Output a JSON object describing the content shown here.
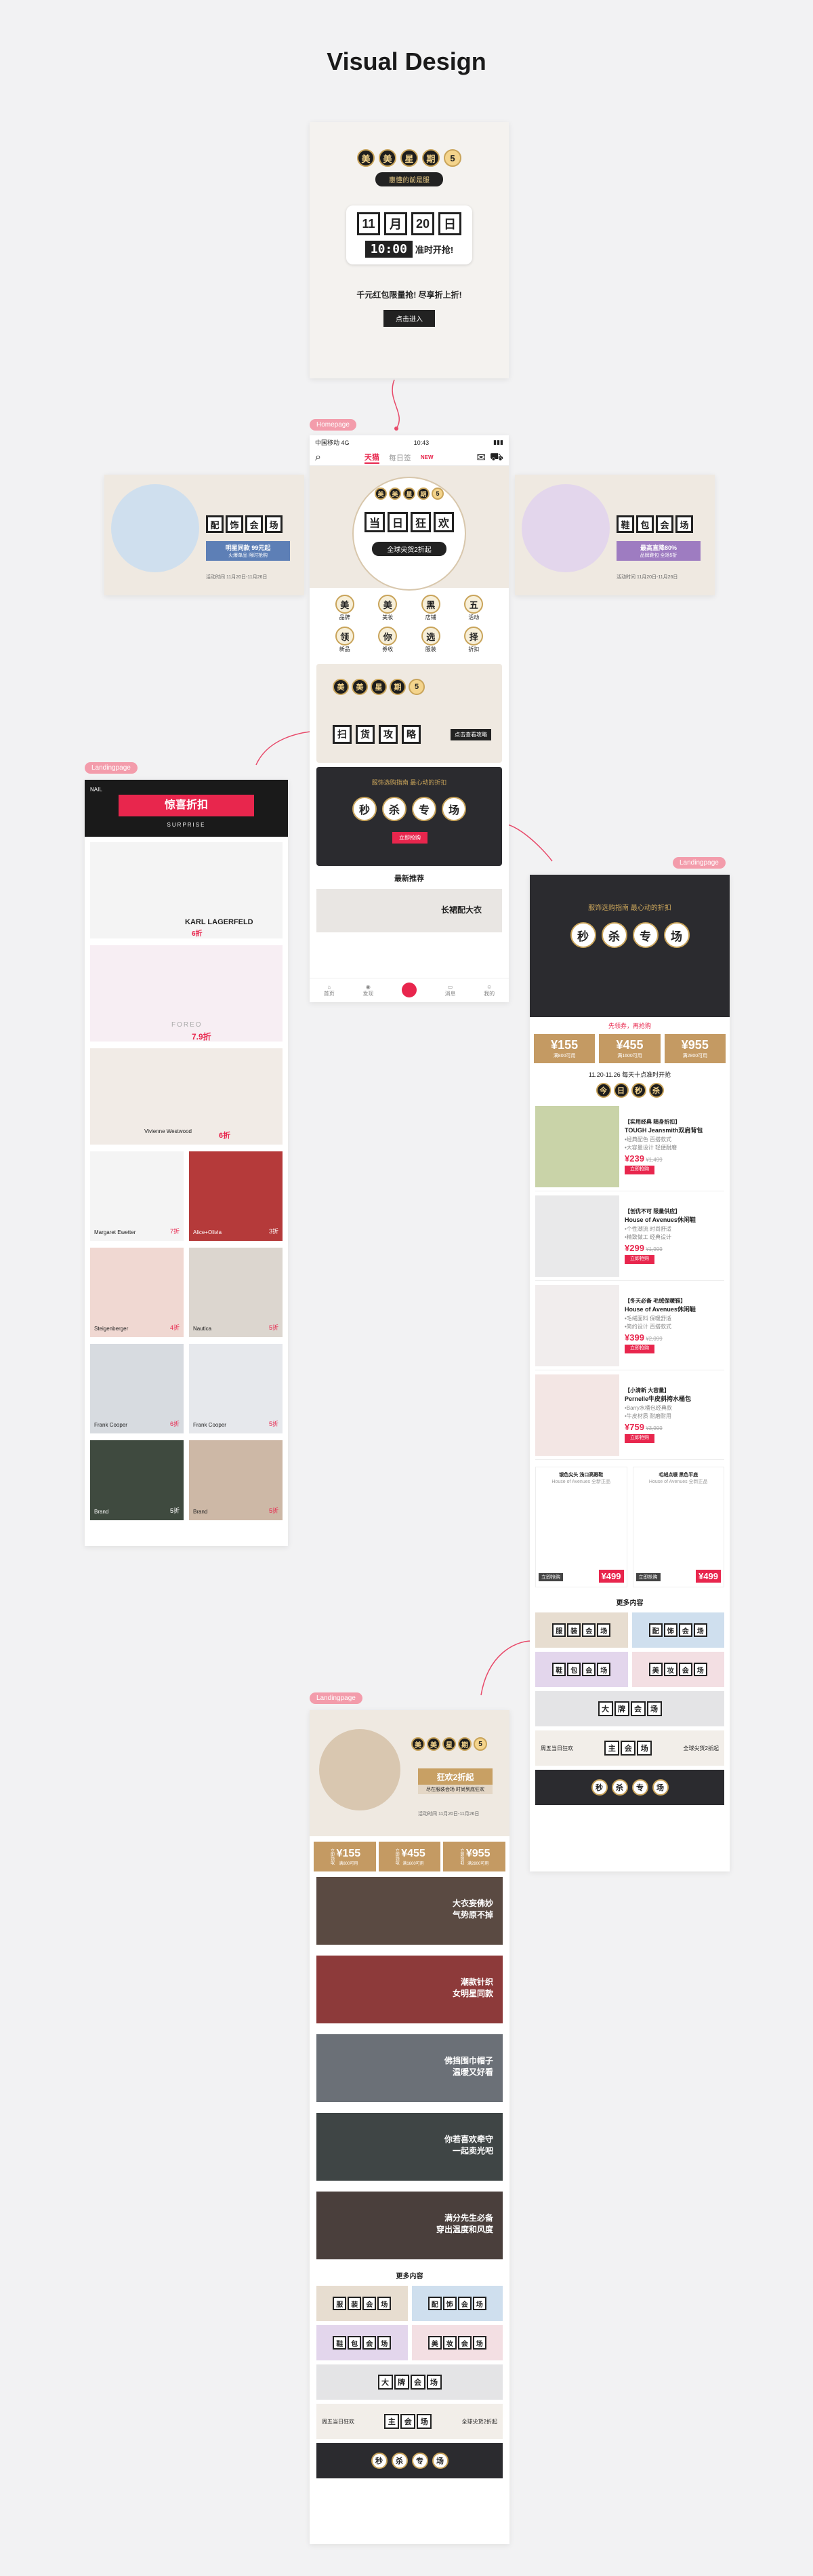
{
  "page_title": "Visual Design",
  "tags": {
    "homepage": "Homepage",
    "landing": "Landingpage"
  },
  "splash": {
    "coins": [
      "美",
      "美",
      "星",
      "期",
      "5"
    ],
    "subtitle": "惠懂的前是服",
    "dates": [
      "11",
      "月",
      "20",
      "日"
    ],
    "time": "10:00",
    "time_suffix": "准时开抢!",
    "slogan": "千元红包限量抢! 尽享折上折!",
    "enter": "点击进入"
  },
  "home": {
    "status": {
      "carrier": "中国移动 4G",
      "time": "10:43"
    },
    "tabs": [
      "天猫",
      "每日签"
    ],
    "new_badge": "NEW",
    "hero_coins": [
      "美",
      "美",
      "星",
      "期",
      "5"
    ],
    "hero_tiles": [
      "当",
      "日",
      "狂",
      "欢"
    ],
    "hero_sub": "全球尖货2折起",
    "grid": [
      {
        "c": "美",
        "l": "品牌"
      },
      {
        "c": "美",
        "l": "美妆"
      },
      {
        "c": "黑",
        "l": "店铺"
      },
      {
        "c": "五",
        "l": "活动"
      },
      {
        "c": "领",
        "l": "新品"
      },
      {
        "c": "你",
        "l": "券收"
      },
      {
        "c": "选",
        "l": "服装"
      },
      {
        "c": "择",
        "l": "折扣"
      }
    ],
    "banner2_coins": [
      "美",
      "美",
      "星",
      "期",
      "5"
    ],
    "banner2_tiles": [
      "扫",
      "货",
      "攻",
      "略"
    ],
    "banner2_btn": "点击查看攻略",
    "banner3_sub": "服饰选购指南 最心动的折扣",
    "banner3_tiles": [
      "秒",
      "杀",
      "专",
      "场"
    ],
    "banner3_btn": "立即抢购",
    "rec_title": "最新推荐",
    "rec_caption": "长裙配大衣",
    "nav": [
      "首页",
      "发现",
      "",
      "消息",
      "我的"
    ]
  },
  "side_banners": {
    "left": {
      "tiles": [
        "配",
        "饰",
        "会",
        "场"
      ],
      "line1": "明星同款 99元起",
      "line2": "火爆单品 限时抢购",
      "date": "活动时间 11月20日-11月26日"
    },
    "right": {
      "tiles": [
        "鞋",
        "包",
        "会",
        "场"
      ],
      "line1": "最高直降80%",
      "line2": "品牌鞋包 全场5折",
      "date": "活动时间 11月20日-11月26日"
    }
  },
  "landing1": {
    "brand_tag": "NAIL",
    "header": "惊喜折扣",
    "sub": "SURPRISE",
    "rows": [
      {
        "brand": "KARL LAGERFELD",
        "discount": "6折"
      },
      {
        "brand": "FOREO",
        "discount": "7.9折"
      },
      {
        "brand": "Vivienne Westwood",
        "discount": "6折"
      },
      {
        "brand": "Margaret Ewetter",
        "discount": "7折",
        "brand2": "Alice+Olivia",
        "discount2": "3折"
      },
      {
        "brand": "Steigenberger",
        "discount": "4折",
        "brand2": "Nautica",
        "discount2": "5折"
      },
      {
        "brand": "Frank Cooper",
        "discount": "6折",
        "brand2": "Frank Cooper",
        "discount2": "5折"
      },
      {
        "brand": "Brand",
        "discount": "5折",
        "brand2": "Brand",
        "discount2": "5折"
      }
    ]
  },
  "landing2": {
    "banner_sub": "服饰选购指南 最心动的折扣",
    "tiles": [
      "秒",
      "杀",
      "专",
      "场"
    ],
    "coupon_note": "先领券，再抢购",
    "coupons": [
      {
        "v": "155",
        "c": "满800可用"
      },
      {
        "v": "455",
        "c": "满1600可用"
      },
      {
        "v": "955",
        "c": "满2800可用"
      }
    ],
    "session": "11.20-11.26 每天十点准时开抢",
    "session_coins": [
      "今",
      "日",
      "秒",
      "杀"
    ],
    "products": [
      {
        "tag": "【实用经典 随身折扣】",
        "name": "TOUGH Jeansmith双肩背包",
        "desc1": "•经典配色 百搭款式",
        "desc2": "•大容量设计 轻便耐磨",
        "price": "239",
        "old": "¥1,499",
        "btn": "立即抢购"
      },
      {
        "tag": "【创优不可 限量供应】",
        "name": "House of Avenues休闲鞋",
        "desc1": "•个性潮流 时尚舒适",
        "desc2": "•精致做工 经典设计",
        "price": "299",
        "old": "¥1,999",
        "btn": "立即抢购"
      },
      {
        "tag": "【冬天必备 毛绒保暖鞋】",
        "name": "House of Avenues休闲鞋",
        "desc1": "•毛绒面料 保暖舒适",
        "desc2": "•简约设计 百搭款式",
        "price": "399",
        "old": "¥2,099",
        "btn": "立即抢购"
      },
      {
        "tag": "【小清新 大容量】",
        "name": "Pernelle牛皮斜挎水桶包",
        "desc1": "•Barry水桶包经典款",
        "desc2": "•牛皮材质 耐磨耐用",
        "price": "759",
        "old": "¥3,999",
        "btn": "立即抢购"
      }
    ],
    "pair": [
      {
        "name": "银色尖头 浅口高跟鞋",
        "brand": "House of Avenues 全新正品",
        "price": "499",
        "btn": "立即抢购"
      },
      {
        "name": "毛绒点缀 黑色平底",
        "brand": "House of Avenues 全新正品",
        "price": "499",
        "btn": "立即抢购"
      }
    ],
    "more_title": "更多内容",
    "more": [
      [
        "服",
        "装",
        "会",
        "场"
      ],
      [
        "配",
        "饰",
        "会",
        "场"
      ],
      [
        "鞋",
        "包",
        "会",
        "场"
      ],
      [
        "美",
        "妆",
        "会",
        "场"
      ],
      [
        "大",
        "牌",
        "会",
        "场"
      ],
      [
        "主",
        "会",
        "场"
      ]
    ],
    "more_bottom_left": "周五当日狂欢",
    "more_bottom_right": "全球尖货2折起",
    "last_tiles": [
      "秒",
      "杀",
      "专",
      "场"
    ]
  },
  "landing3": {
    "coins": [
      "美",
      "美",
      "星",
      "期",
      "5"
    ],
    "badge": "狂欢2折起",
    "badge_sub1": "尽在服装会场",
    "badge_sub2": "时尚到底狂欢",
    "date": "活动时间 11月20日-11月26日",
    "coupons": [
      {
        "v": "155",
        "c": "满800可用"
      },
      {
        "v": "455",
        "c": "满1600可用"
      },
      {
        "v": "955",
        "c": "满2800可用"
      }
    ],
    "coupon_label": "立即领取",
    "features": [
      {
        "l1": "大衣妄佛妙",
        "l2": "气势原不掉"
      },
      {
        "l1": "潮款针织",
        "l2": "女明星同款"
      },
      {
        "l1": "佛挡围巾帽子",
        "l2": "温暖又好看"
      },
      {
        "l1": "你若喜欢牵守",
        "l2": "一起卖光吧"
      },
      {
        "l1": "满分先生必备",
        "l2": "穿出温度和风度"
      }
    ],
    "more_title": "更多内容",
    "more": [
      [
        "服",
        "装",
        "会",
        "场"
      ],
      [
        "配",
        "饰",
        "会",
        "场"
      ],
      [
        "鞋",
        "包",
        "会",
        "场"
      ],
      [
        "美",
        "妆",
        "会",
        "场"
      ],
      [
        "大",
        "牌",
        "会",
        "场"
      ],
      [
        "主",
        "会",
        "场"
      ]
    ],
    "more_bottom_left": "周五当日狂欢",
    "more_bottom_right": "全球尖货2折起",
    "last_tiles": [
      "秒",
      "杀",
      "专",
      "场"
    ]
  },
  "colors": {
    "accent": "#e8264d",
    "gold": "#c49a63",
    "dark": "#2b2b2f",
    "tag": "#f39cab"
  }
}
